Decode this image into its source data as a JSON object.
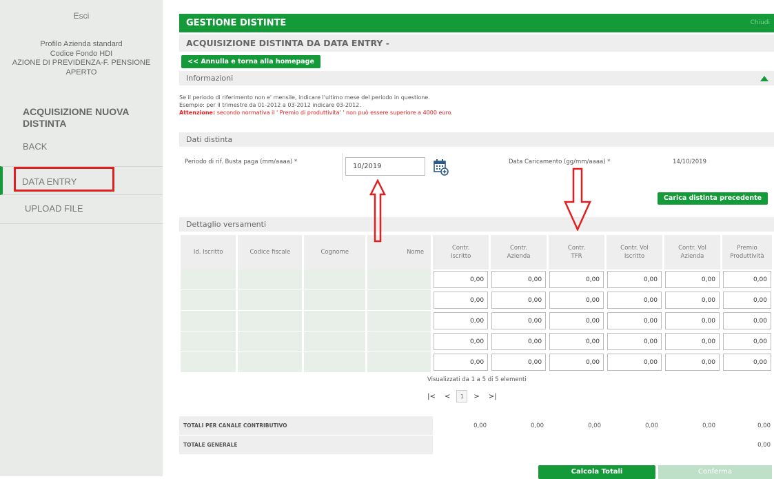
{
  "sidebar": {
    "esci": "Esci",
    "profile_lines": [
      "Profilo Azienda standard",
      "Codice Fondo HDI",
      "AZIONE DI PREVIDENZA-F. PENSIONE",
      "APERTO"
    ],
    "section_title": "ACQUISIZIONE NUOVA DISTINTA",
    "back": "BACK",
    "data_entry": "DATA ENTRY",
    "upload_file": "UPLOAD FILE"
  },
  "header": {
    "title": "GESTIONE DISTINTE",
    "right_link": "Chiudi",
    "subtitle": "ACQUISIZIONE DISTINTA DA DATA ENTRY -",
    "home_button": "<< Annulla e torna alla homepage"
  },
  "info": {
    "section": "Informazioni",
    "line1": "Se il periodo di riferimento non e' mensile, indicare l'ultimo mese del periodo in questione.",
    "line2": "Esempio: per il trimestre da 01-2012 a 03-2012 indicare 03-2012.",
    "attention_label": "Attenzione:",
    "attention_text": " secondo normativa il ' Premio di produttivita' ' non può essere superiore a 4000 euro."
  },
  "dati": {
    "section": "Dati distinta",
    "periodo_label": "Periodo di rif. Busta paga (mm/aaaa) *",
    "periodo_value": "10/2019",
    "data_caricamento_label": "Data Caricamento (gg/mm/aaaa) *",
    "data_caricamento_value": "14/10/2019",
    "carica_button": "Carica distinta precedente"
  },
  "dettaglio": {
    "section": "Dettaglio versamenti",
    "columns": [
      "Id. Iscritto",
      "Codice fiscale",
      "Cognome",
      "Nome",
      "Contr. Iscritto",
      "Contr. Azienda",
      "Contr. TFR",
      "Contr. Vol Iscritto",
      "Contr. Vol Azienda",
      "Premio Produttività"
    ],
    "row_value": "0,00",
    "pagination_info": "Visualizzati da 1 a 5 di 5 elementi",
    "page": "1"
  },
  "totali": {
    "canale_label": "TOTALI PER CANALE CONTRIBUTIVO",
    "canale_values": [
      "0,00",
      "0,00",
      "0,00",
      "0,00",
      "0,00",
      "0,00"
    ],
    "generale_label": "TOTALE GENERALE",
    "generale_value": "0,00"
  },
  "actions": {
    "calcola": "Calcola Totali",
    "conferma": "Conferma"
  }
}
